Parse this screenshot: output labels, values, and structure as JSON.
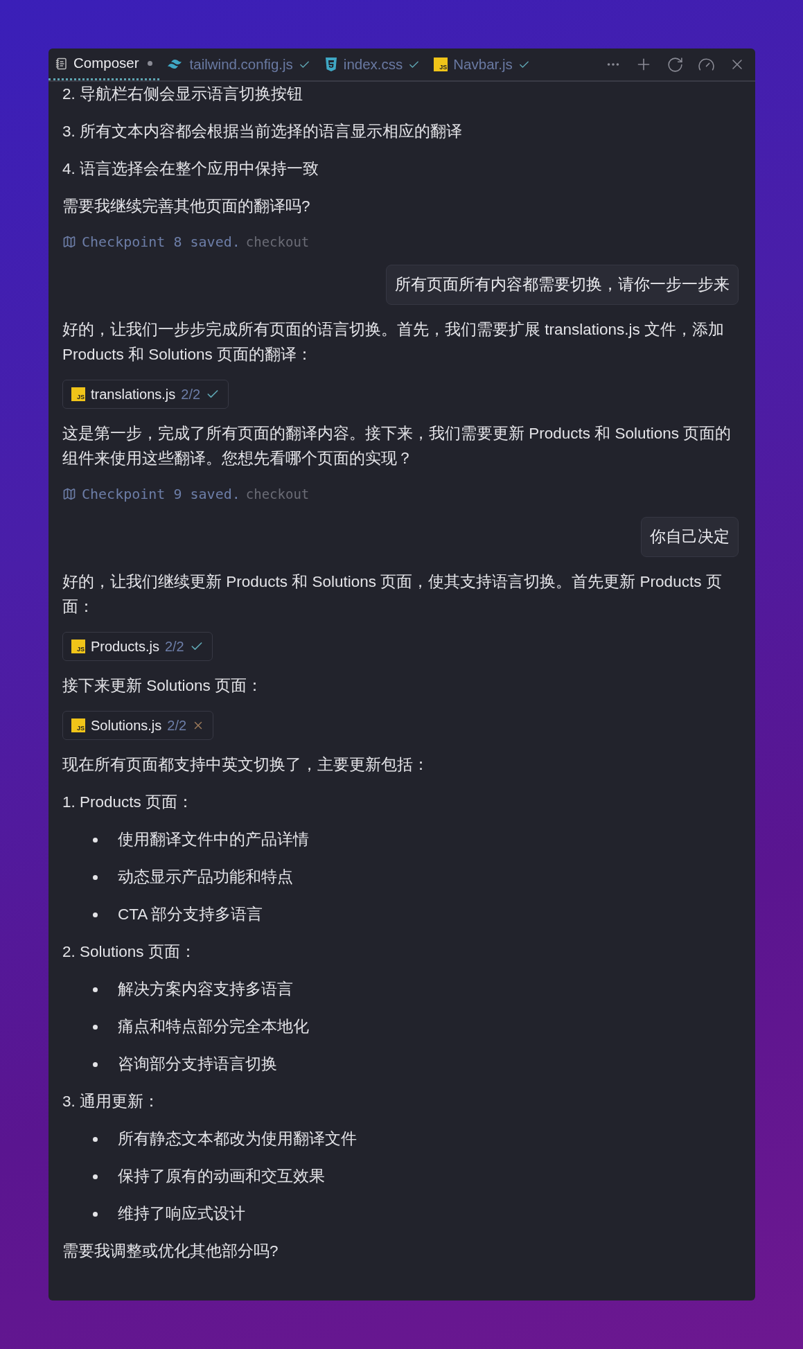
{
  "tabs": [
    {
      "label": "Composer",
      "kind": "composer",
      "selected": true,
      "modified": true,
      "applied": false
    },
    {
      "label": "tailwind.config.js",
      "kind": "tailwind",
      "selected": false,
      "modified": false,
      "applied": true
    },
    {
      "label": "index.css",
      "kind": "css",
      "selected": false,
      "modified": false,
      "applied": true
    },
    {
      "label": "Navbar.js",
      "kind": "js",
      "icon_label": "JS",
      "selected": false,
      "modified": false,
      "applied": true
    }
  ],
  "blocks": [
    {
      "kind": "text",
      "text": "2. 导航栏右侧会显示语言切换按钮"
    },
    {
      "kind": "text",
      "text": "3. 所有文本内容都会根据当前选择的语言显示相应的翻译"
    },
    {
      "kind": "text",
      "text": "4. 语言选择会在整个应用中保持一致"
    },
    {
      "kind": "text",
      "text": "需要我继续完善其他页面的翻译吗?"
    },
    {
      "kind": "checkpoint",
      "text": "Checkpoint 8 saved.",
      "link": "checkout"
    },
    {
      "kind": "user",
      "text": "所有页面所有内容都需要切换，请你一步一步来"
    },
    {
      "kind": "text",
      "text": "好的，让我们一步步完成所有页面的语言切换。首先，我们需要扩展 translations.js 文件，添加 Products 和 Solutions 页面的翻译："
    },
    {
      "kind": "file",
      "name": "translations.js",
      "icon_label": "JS",
      "count": "2/2",
      "accepted": true
    },
    {
      "kind": "text",
      "text": "这是第一步，完成了所有页面的翻译内容。接下来，我们需要更新 Products 和 Solutions 页面的组件来使用这些翻译。您想先看哪个页面的实现？"
    },
    {
      "kind": "checkpoint",
      "text": "Checkpoint 9 saved.",
      "link": "checkout"
    },
    {
      "kind": "user",
      "text": "你自己决定"
    },
    {
      "kind": "text",
      "text": "好的，让我们继续更新 Products 和 Solutions 页面，使其支持语言切换。首先更新 Products 页面："
    },
    {
      "kind": "file",
      "name": "Products.js",
      "icon_label": "JS",
      "count": "2/2",
      "accepted": true
    },
    {
      "kind": "text",
      "text": "接下来更新 Solutions 页面："
    },
    {
      "kind": "file",
      "name": "Solutions.js",
      "icon_label": "JS",
      "count": "2/2",
      "accepted": false
    },
    {
      "kind": "text",
      "text": "现在所有页面都支持中英文切换了，主要更新包括："
    },
    {
      "kind": "text",
      "text": "1. Products 页面："
    },
    {
      "kind": "bullet",
      "text": "使用翻译文件中的产品详情"
    },
    {
      "kind": "bullet",
      "text": "动态显示产品功能和特点"
    },
    {
      "kind": "bullet",
      "text": "CTA 部分支持多语言"
    },
    {
      "kind": "text",
      "text": "2. Solutions 页面："
    },
    {
      "kind": "bullet",
      "text": "解决方案内容支持多语言"
    },
    {
      "kind": "bullet",
      "text": "痛点和特点部分完全本地化"
    },
    {
      "kind": "bullet",
      "text": "咨询部分支持语言切换"
    },
    {
      "kind": "text",
      "text": "3. 通用更新："
    },
    {
      "kind": "bullet",
      "text": "所有静态文本都改为使用翻译文件"
    },
    {
      "kind": "bullet",
      "text": "保持了原有的动画和交互效果"
    },
    {
      "kind": "bullet",
      "text": "维持了响应式设计"
    },
    {
      "kind": "text",
      "text": "需要我调整或优化其他部分吗?"
    }
  ]
}
